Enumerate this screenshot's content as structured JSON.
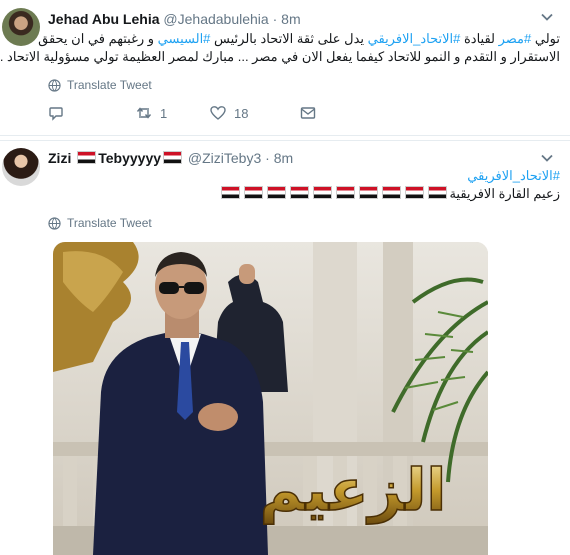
{
  "tweets": [
    {
      "name": "Jehad Abu Lehia",
      "handle": "@Jehadabulehia",
      "dot": "·",
      "time": "8m",
      "text_line1_parts": [
        "تولي ",
        "#مصر",
        " لقيادة ",
        "#الاتحاد_الافريقي",
        " يدل على ثقة الاتحاد بالرئيس ",
        "#السيسي",
        " و رغبتهم في ان يحقق"
      ],
      "text_line2": "الاستقرار و التقدم و النمو للاتحاد كيفما يفعل الان في مصر ... مبارك لمصر العظيمة تولي مسؤولية الاتحاد ...",
      "translate_label": "Translate Tweet",
      "reply_icon": "reply-icon",
      "retweet_icon": "retweet-icon",
      "retweet_count": "1",
      "like_icon": "heart-icon",
      "like_count": "18",
      "dm_icon": "envelope-icon"
    },
    {
      "name_before_flag": "Zizi",
      "name_after_flag": "Tebyyyyy",
      "handle": "@ZiziTeby3",
      "dot": "·",
      "time": "8m",
      "hashtag": "#الاتحاد_الافريقي",
      "text_line2": "زعيم القارة الافريقية",
      "translate_label": "Translate Tweet",
      "photo_caption": "الزعيم"
    }
  ],
  "colors": {
    "link": "#1da1f2",
    "secondary": "#657786",
    "border": "#e6ecf0",
    "flag_red": "#ce1126",
    "flag_black": "#111111"
  }
}
